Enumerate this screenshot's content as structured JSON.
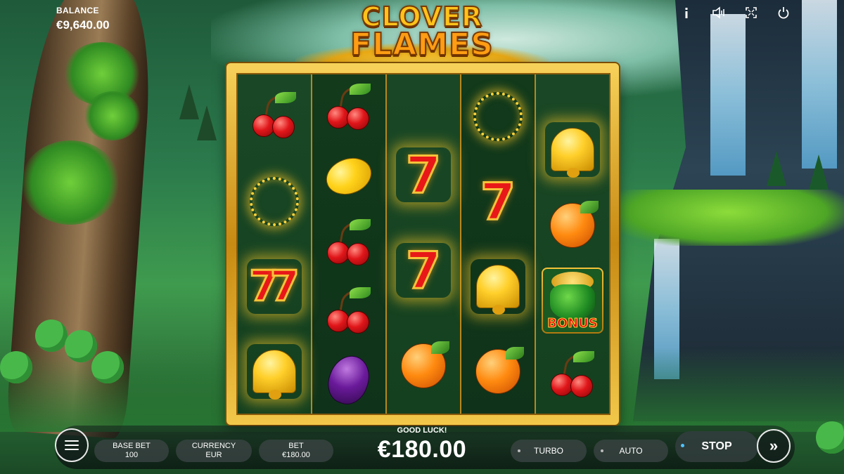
{
  "hud": {
    "balance_label": "BALANCE",
    "balance_value": "€9,640.00",
    "icons": [
      "info-icon",
      "sound-icon",
      "fullscreen-icon",
      "power-icon"
    ]
  },
  "logo": {
    "line1": "CLOVER",
    "line2": "FLAMES"
  },
  "reels": [
    [
      "cherry",
      "fire-ring",
      "seven-pair",
      "bell"
    ],
    [
      "cherry",
      "lemon",
      "cherry",
      "cherry",
      "plum"
    ],
    [
      "seven",
      "seven",
      "orange"
    ],
    [
      "fire-ring",
      "seven",
      "bell",
      "orange"
    ],
    [
      "bell",
      "orange",
      "bonus-pot",
      "cherry"
    ]
  ],
  "bonus_label": "BONUS",
  "controls": {
    "base_bet_label": "BASE BET",
    "base_bet_value": "100",
    "currency_label": "CURRENCY",
    "currency_value": "EUR",
    "bet_label": "BET",
    "bet_value": "€180.00",
    "status_text": "GOOD LUCK!",
    "win_amount": "€180.00",
    "turbo_label": "TURBO",
    "auto_label": "AUTO",
    "stop_label": "STOP",
    "spin_glyph": "»"
  },
  "colors": {
    "reel_bg": "#0f3a1c",
    "frame_gold": "#f2c84a",
    "stop_dot": "#4fc3ff"
  }
}
